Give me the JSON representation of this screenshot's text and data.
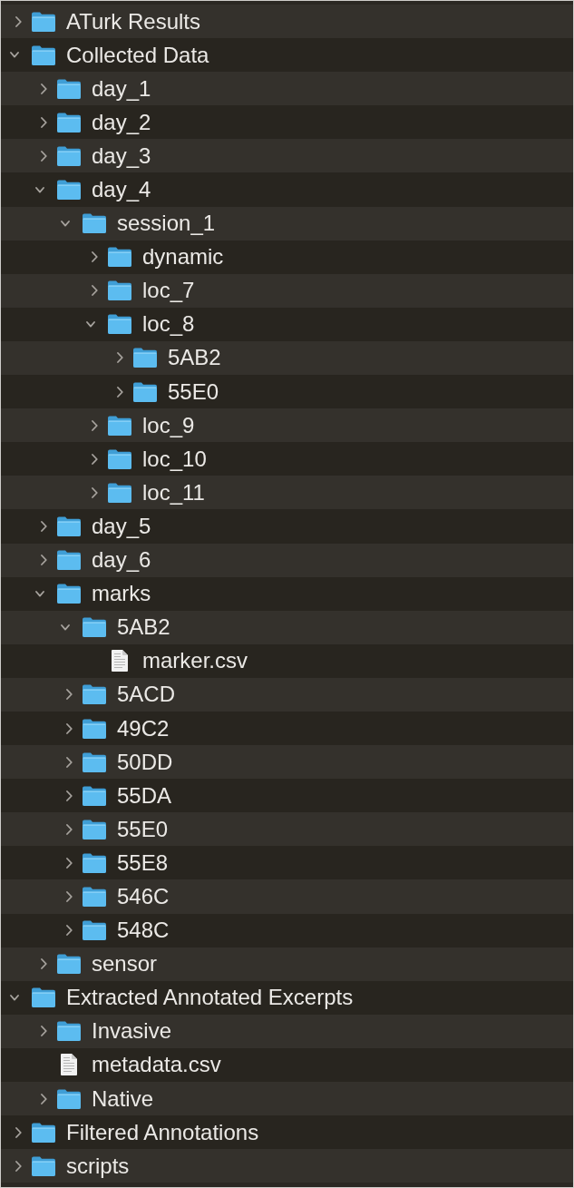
{
  "tree": [
    {
      "kind": "folder",
      "name": "ATurk Results",
      "expanded": false
    },
    {
      "kind": "folder",
      "name": "Collected Data",
      "expanded": true,
      "children": [
        {
          "kind": "folder",
          "name": "day_1",
          "expanded": false
        },
        {
          "kind": "folder",
          "name": "day_2",
          "expanded": false
        },
        {
          "kind": "folder",
          "name": "day_3",
          "expanded": false
        },
        {
          "kind": "folder",
          "name": "day_4",
          "expanded": true,
          "children": [
            {
              "kind": "folder",
              "name": "session_1",
              "expanded": true,
              "children": [
                {
                  "kind": "folder",
                  "name": "dynamic",
                  "expanded": false
                },
                {
                  "kind": "folder",
                  "name": "loc_7",
                  "expanded": false
                },
                {
                  "kind": "folder",
                  "name": "loc_8",
                  "expanded": true,
                  "children": [
                    {
                      "kind": "folder",
                      "name": "5AB2",
                      "expanded": false
                    },
                    {
                      "kind": "folder",
                      "name": "55E0",
                      "expanded": false
                    }
                  ]
                },
                {
                  "kind": "folder",
                  "name": "loc_9",
                  "expanded": false
                },
                {
                  "kind": "folder",
                  "name": "loc_10",
                  "expanded": false
                },
                {
                  "kind": "folder",
                  "name": "loc_11",
                  "expanded": false
                }
              ]
            }
          ]
        },
        {
          "kind": "folder",
          "name": "day_5",
          "expanded": false
        },
        {
          "kind": "folder",
          "name": "day_6",
          "expanded": false
        },
        {
          "kind": "folder",
          "name": "marks",
          "expanded": true,
          "children": [
            {
              "kind": "folder",
              "name": "5AB2",
              "expanded": true,
              "children": [
                {
                  "kind": "file",
                  "name": "marker.csv"
                }
              ]
            },
            {
              "kind": "folder",
              "name": "5ACD",
              "expanded": false
            },
            {
              "kind": "folder",
              "name": "49C2",
              "expanded": false
            },
            {
              "kind": "folder",
              "name": "50DD",
              "expanded": false
            },
            {
              "kind": "folder",
              "name": "55DA",
              "expanded": false
            },
            {
              "kind": "folder",
              "name": "55E0",
              "expanded": false
            },
            {
              "kind": "folder",
              "name": "55E8",
              "expanded": false
            },
            {
              "kind": "folder",
              "name": "546C",
              "expanded": false
            },
            {
              "kind": "folder",
              "name": "548C",
              "expanded": false
            }
          ]
        },
        {
          "kind": "folder",
          "name": "sensor",
          "expanded": false
        }
      ]
    },
    {
      "kind": "folder",
      "name": "Extracted Annotated Excerpts",
      "expanded": true,
      "children": [
        {
          "kind": "folder",
          "name": "Invasive",
          "expanded": false
        },
        {
          "kind": "file",
          "name": "metadata.csv"
        },
        {
          "kind": "folder",
          "name": "Native",
          "expanded": false
        }
      ]
    },
    {
      "kind": "folder",
      "name": "Filtered Annotations",
      "expanded": false
    },
    {
      "kind": "folder",
      "name": "scripts",
      "expanded": false
    }
  ]
}
